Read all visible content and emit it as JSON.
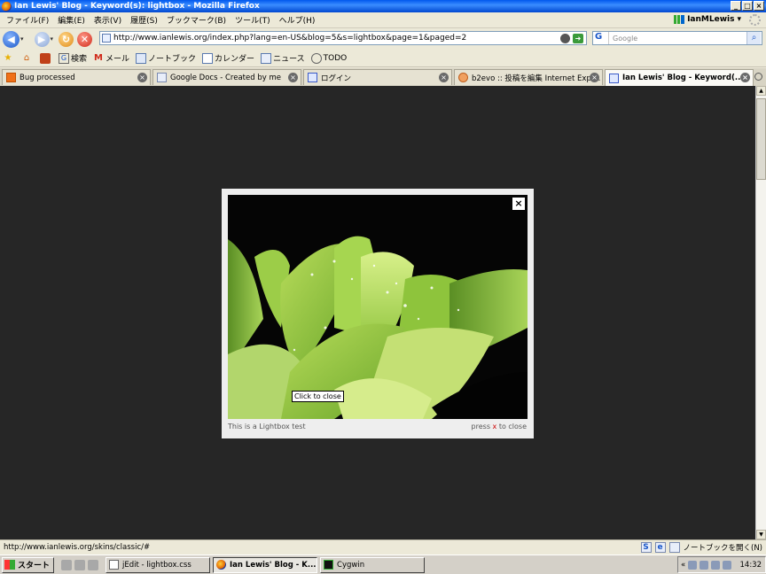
{
  "window": {
    "title": "Ian Lewis' Blog - Keyword(s): lightbox - Mozilla Firefox",
    "buttons": [
      "_",
      "□",
      "×"
    ]
  },
  "menu": {
    "items": [
      "ファイル(F)",
      "編集(E)",
      "表示(V)",
      "履歴(S)",
      "ブックマーク(B)",
      "ツール(T)",
      "ヘルプ(H)"
    ],
    "profile": "IanMLewis"
  },
  "nav": {
    "url": "http://www.ianlewis.org/index.php?lang=en-US&blog=5&s=lightbox&page=1&paged=2",
    "search_placeholder": "Google"
  },
  "bookmarks": [
    {
      "label": "",
      "icon": "star-icon"
    },
    {
      "label": "",
      "icon": "home-icon"
    },
    {
      "label": "",
      "icon": "firefox-icon"
    },
    {
      "label": "検索",
      "icon": "google-icon"
    },
    {
      "label": "メール",
      "icon": "gmail-icon"
    },
    {
      "label": "ノートブック",
      "icon": "notebook-icon"
    },
    {
      "label": "カレンダー",
      "icon": "calendar-icon"
    },
    {
      "label": "ニュース",
      "icon": "news-icon"
    },
    {
      "label": "TODO",
      "icon": "todo-icon"
    }
  ],
  "tabs": [
    {
      "title": "Bug processed",
      "active": false
    },
    {
      "title": "Google Docs - Created by me",
      "active": false
    },
    {
      "title": "ログイン",
      "active": false
    },
    {
      "title": "b2evo :: 投稿を編集 Internet Expl...",
      "active": false
    },
    {
      "title": "Ian Lewis' Blog - Keyword(...",
      "active": true
    }
  ],
  "lightbox": {
    "close": "×",
    "tooltip": "Click to close",
    "caption": "This is a Lightbox test",
    "hint_prefix": "press",
    "hint_key": "x",
    "hint_suffix": "to close"
  },
  "status": {
    "text": "http://www.ianlewis.org/skins/classic/#",
    "notebook": "ノートブックを開く(N)"
  },
  "taskbar": {
    "start": "スタート",
    "tasks": [
      {
        "label": "jEdit - lightbox.css",
        "active": false
      },
      {
        "label": "Ian Lewis' Blog - K...",
        "active": true
      },
      {
        "label": "Cygwin",
        "active": false
      }
    ],
    "tray_prefix": "«",
    "clock": "14:32"
  },
  "colors": {
    "overlay": "#262626",
    "lightbox_bg": "#eeeeee",
    "titlebar": "#0058ee"
  }
}
